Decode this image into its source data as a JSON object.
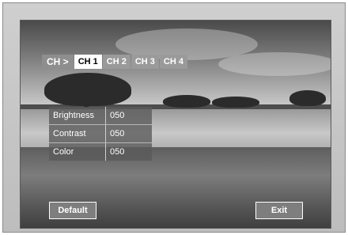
{
  "tabs": {
    "prefix": "CH >",
    "items": [
      "CH 1",
      "CH 2",
      "CH 3",
      "CH 4"
    ],
    "selected": "CH 1"
  },
  "settings": [
    {
      "label": "Brightness",
      "value": "050"
    },
    {
      "label": "Contrast",
      "value": "050"
    },
    {
      "label": "Color",
      "value": "050"
    }
  ],
  "buttons": {
    "default_label": "Default",
    "exit_label": "Exit"
  },
  "colors": {
    "overlay_gray": "#5a5a5a",
    "tab_inactive": "#9a9a9a",
    "tab_active": "#ffffff",
    "frame": "#c4c4c4"
  }
}
